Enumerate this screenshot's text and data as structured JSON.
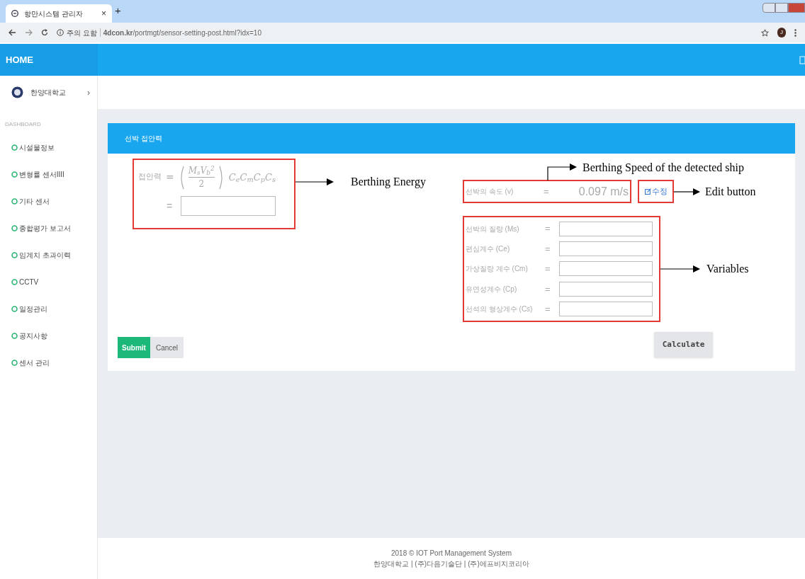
{
  "browser": {
    "tab_title": "항만시스템 관리자",
    "tab_close": "×",
    "new_tab": "+",
    "security_label": "주의 요함",
    "url": "**4dcon.kr**/portmgt/sensor-setting-post.html?idx=10",
    "avatar": "J"
  },
  "header": {
    "brand": "HOME"
  },
  "sidebar": {
    "org": "한양대학교",
    "org_chevron": "›",
    "section": "DASHBOARD",
    "items": [
      {
        "label": "시설물정보"
      },
      {
        "label": "변형률 센서IIII"
      },
      {
        "label": "기타 센서"
      },
      {
        "label": "종합평가 보고서"
      },
      {
        "label": "임계치 초과이력"
      },
      {
        "label": "CCTV"
      },
      {
        "label": "일정관리"
      },
      {
        "label": "공지사항"
      },
      {
        "label": "센서 관리"
      }
    ]
  },
  "card": {
    "title": "선박 접안력",
    "formula": {
      "label": "접안력",
      "eq": "=",
      "numerator": "M$_{s}$V$_{b}$$^{2}$",
      "denominator": "2",
      "factors": "C$_{e}$C$_{m}$C$_{p}$C$_{s}$",
      "result_eq": "="
    },
    "speed": {
      "label": "선박의 속도 (v)",
      "eq": "=",
      "value": "0.097 m/s"
    },
    "edit_button": "수정",
    "variables": [
      {
        "label": "선박의 질량 (Ms)",
        "eq": "="
      },
      {
        "label": "편심계수 (Ce)",
        "eq": "="
      },
      {
        "label": "가상질량 계수 (Cm)",
        "eq": "="
      },
      {
        "label": "유연성계수 (Cp)",
        "eq": "="
      },
      {
        "label": "선석의 형상계수 (Cs)",
        "eq": "="
      }
    ],
    "submit": "Submit",
    "cancel": "Cancel",
    "calculate": "Calculate"
  },
  "annotations": {
    "energy": "Berthing Energy",
    "speed": "Berthing Speed of the detected ship",
    "edit": "Edit button",
    "variables": "Variables"
  },
  "footer": {
    "lines": [
      "2018 © IOT Port Management System",
      "한양대학교 | (주)다음기술단 | (주)에프비지코리아"
    ]
  }
}
